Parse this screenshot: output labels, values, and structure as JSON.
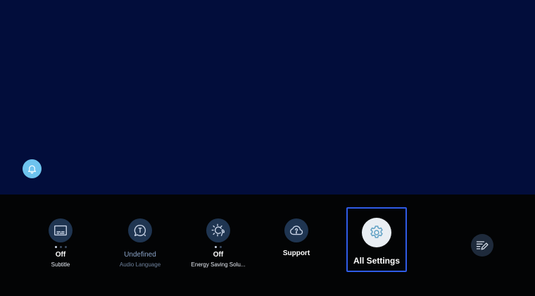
{
  "colors": {
    "screen_bg": "#020d3b",
    "tray_bg": "#030405",
    "focus_border": "#2f5be6",
    "notification_button": "#6ec3ee"
  },
  "notification": {
    "icon": "bell-icon"
  },
  "quick_settings": {
    "items": [
      {
        "id": "subtitle",
        "icon": "subtitle-icon",
        "value": "Off",
        "label": "Subtitle",
        "pages": 3,
        "active_page": 1,
        "dimmed": false
      },
      {
        "id": "audio-language",
        "icon": "audio-language-icon",
        "value": "Undefined",
        "label": "Audio Language",
        "dimmed": true
      },
      {
        "id": "energy-saving",
        "icon": "energy-saving-icon",
        "value": "Off",
        "label": "Energy Saving Solu...",
        "pages": 2,
        "active_page": 1,
        "dimmed": false
      },
      {
        "id": "support",
        "icon": "support-cloud-icon",
        "value": "Support",
        "label": "",
        "dimmed": false
      }
    ],
    "focused": {
      "label": "All Settings",
      "icon": "gear-icon"
    },
    "edit": {
      "icon": "edit-list-icon"
    }
  }
}
